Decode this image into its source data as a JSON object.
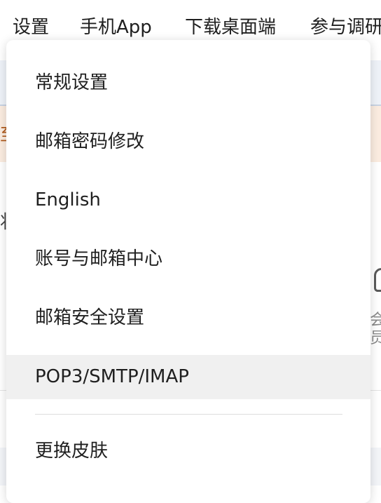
{
  "nav": {
    "settings": "设置",
    "mobile_app": "手机App",
    "desktop": "下载桌面端",
    "survey": "参与调研"
  },
  "background": {
    "notice_fragment": "至",
    "left_fragment": "状",
    "right_fragment": "会员"
  },
  "menu": {
    "items": [
      {
        "label": "常规设置"
      },
      {
        "label": "邮箱密码修改"
      },
      {
        "label": "English"
      },
      {
        "label": "账号与邮箱中心"
      },
      {
        "label": "邮箱安全设置"
      },
      {
        "label": "POP3/SMTP/IMAP",
        "hovered": true
      },
      {
        "label": "更换皮肤"
      }
    ]
  },
  "colors": {
    "menu_hover_bg": "#f0f0f0",
    "notice_bg": "#fbece0",
    "tab_strip_bg": "#eef2f8"
  }
}
